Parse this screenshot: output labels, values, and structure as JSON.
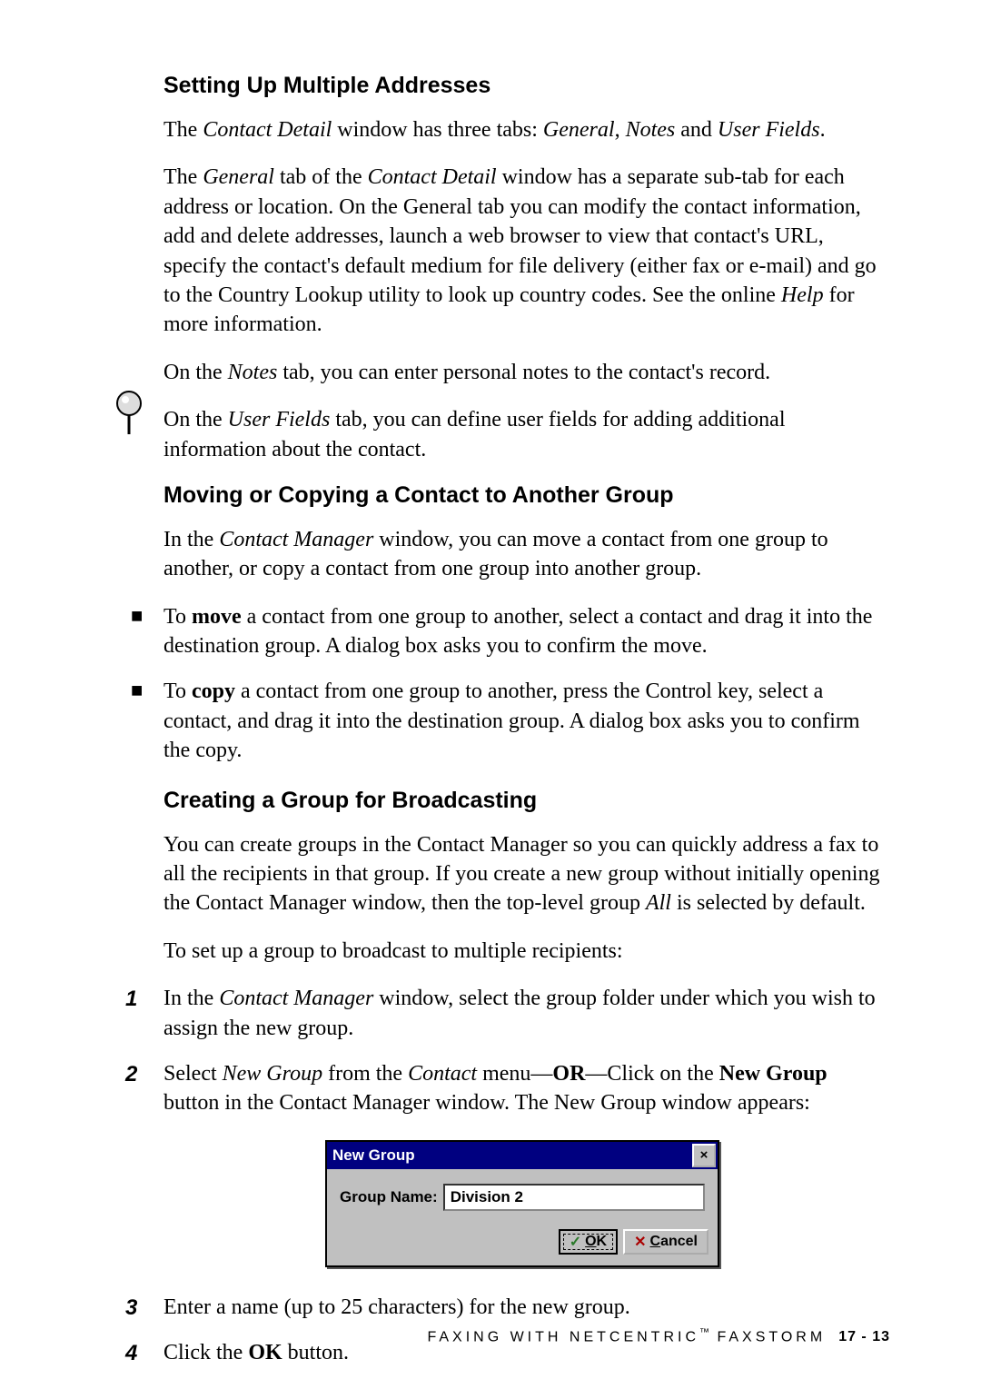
{
  "section1": {
    "title": "Setting Up Multiple Addresses",
    "p1_a": "The ",
    "p1_b": "Contact Detail",
    "p1_c": " window has three tabs: ",
    "p1_d": "General",
    "p1_e": ", ",
    "p1_f": "Notes",
    "p1_g": " and ",
    "p1_h": "User Fields",
    "p1_i": ".",
    "p2_a": "The ",
    "p2_b": "General",
    "p2_c": " tab of the ",
    "p2_d": "Contact Detail",
    "p2_e": " window has a separate sub-tab for each address or location. On the General tab you can modify the contact information, add and delete addresses, launch a web browser to view that contact's URL, specify the contact's default medium for file delivery (either fax or e-mail) and go to the Country Lookup utility to look up country codes. See the online ",
    "p2_f": "Help",
    "p2_g": " for more information.",
    "p3_a": "On the ",
    "p3_b": "Notes",
    "p3_c": " tab, you can enter personal notes to the contact's record.",
    "p4_a": "On the ",
    "p4_b": "User Fields",
    "p4_c": " tab, you can define user fields for adding additional information about the contact."
  },
  "section2": {
    "title": "Moving or Copying a Contact to Another Group",
    "p1_a": "In the ",
    "p1_b": "Contact Manager",
    "p1_c": " window, you can move a contact from one group to another, or copy a contact from one group into another group.",
    "b1_a": "To ",
    "b1_b": "move",
    "b1_c": " a contact from one group to another, select a contact and drag it into the destination group. A dialog box asks you to confirm the move.",
    "b2_a": "To ",
    "b2_b": "copy",
    "b2_c": " a contact from one group to another, press the Control key, select a contact, and drag it into the destination group. A dialog box asks you to confirm the copy."
  },
  "section3": {
    "title": "Creating a Group for Broadcasting",
    "p1_a": "You can create groups in the Contact Manager so you can quickly address a fax to all the recipients in that group. If you create a new group without initially opening the Contact Manager window, then the top-level group ",
    "p1_b": "All",
    "p1_c": " is selected by default.",
    "p2": "To set up a group to broadcast to multiple recipients:",
    "s1_a": "In the ",
    "s1_b": "Contact Manager",
    "s1_c": " window, select the group folder under which you wish to assign the new group.",
    "s2_a": "Select ",
    "s2_b": "New Group",
    "s2_c": " from the ",
    "s2_d": "Contact",
    "s2_e": " menu—",
    "s2_f": "OR",
    "s2_g": "—Click on the ",
    "s2_h": "New Group",
    "s2_i": " button in the Contact Manager window. The New Group window appears:",
    "s3": "Enter a name (up to 25 characters) for the new group.",
    "s4_a": "Click the ",
    "s4_b": "OK",
    "s4_c": " button."
  },
  "steps": {
    "n1": "1",
    "n2": "2",
    "n3": "3",
    "n4": "4"
  },
  "bullet": "■",
  "dialog": {
    "title": "New Group",
    "close": "×",
    "field_label": "Group Name:",
    "field_value": "Division 2",
    "ok_prefix": "O",
    "ok_rest": "K",
    "cancel_prefix": "C",
    "cancel_rest": "ancel",
    "check": "✓",
    "x": "✕"
  },
  "footer": {
    "text_a": "FAXING WITH NETCENTRIC",
    "tm": "™",
    "text_b": " FAXSTORM",
    "page": "17 - 13"
  }
}
